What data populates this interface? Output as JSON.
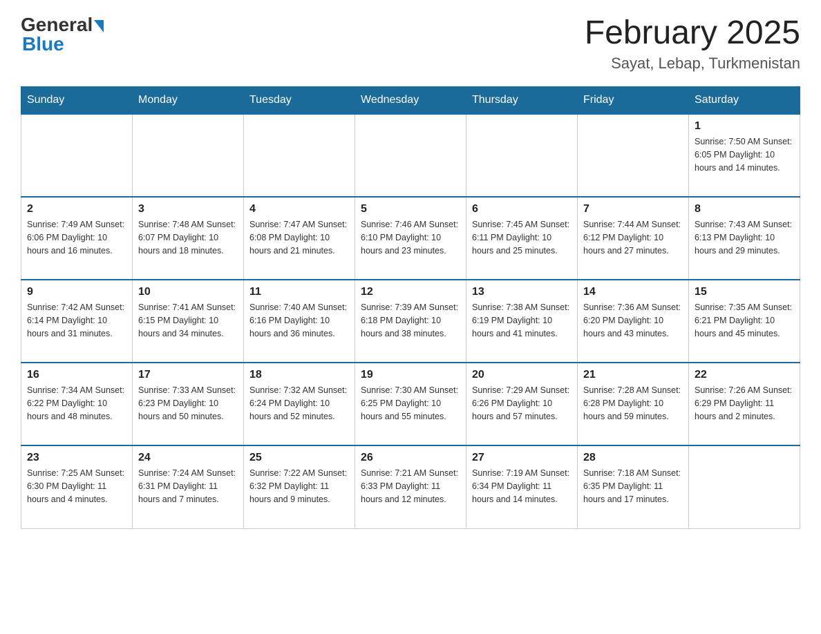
{
  "header": {
    "logo_general": "General",
    "logo_blue": "Blue",
    "month_title": "February 2025",
    "subtitle": "Sayat, Lebap, Turkmenistan"
  },
  "days_of_week": [
    "Sunday",
    "Monday",
    "Tuesday",
    "Wednesday",
    "Thursday",
    "Friday",
    "Saturday"
  ],
  "weeks": [
    [
      {
        "day": "",
        "info": ""
      },
      {
        "day": "",
        "info": ""
      },
      {
        "day": "",
        "info": ""
      },
      {
        "day": "",
        "info": ""
      },
      {
        "day": "",
        "info": ""
      },
      {
        "day": "",
        "info": ""
      },
      {
        "day": "1",
        "info": "Sunrise: 7:50 AM\nSunset: 6:05 PM\nDaylight: 10 hours and 14 minutes."
      }
    ],
    [
      {
        "day": "2",
        "info": "Sunrise: 7:49 AM\nSunset: 6:06 PM\nDaylight: 10 hours and 16 minutes."
      },
      {
        "day": "3",
        "info": "Sunrise: 7:48 AM\nSunset: 6:07 PM\nDaylight: 10 hours and 18 minutes."
      },
      {
        "day": "4",
        "info": "Sunrise: 7:47 AM\nSunset: 6:08 PM\nDaylight: 10 hours and 21 minutes."
      },
      {
        "day": "5",
        "info": "Sunrise: 7:46 AM\nSunset: 6:10 PM\nDaylight: 10 hours and 23 minutes."
      },
      {
        "day": "6",
        "info": "Sunrise: 7:45 AM\nSunset: 6:11 PM\nDaylight: 10 hours and 25 minutes."
      },
      {
        "day": "7",
        "info": "Sunrise: 7:44 AM\nSunset: 6:12 PM\nDaylight: 10 hours and 27 minutes."
      },
      {
        "day": "8",
        "info": "Sunrise: 7:43 AM\nSunset: 6:13 PM\nDaylight: 10 hours and 29 minutes."
      }
    ],
    [
      {
        "day": "9",
        "info": "Sunrise: 7:42 AM\nSunset: 6:14 PM\nDaylight: 10 hours and 31 minutes."
      },
      {
        "day": "10",
        "info": "Sunrise: 7:41 AM\nSunset: 6:15 PM\nDaylight: 10 hours and 34 minutes."
      },
      {
        "day": "11",
        "info": "Sunrise: 7:40 AM\nSunset: 6:16 PM\nDaylight: 10 hours and 36 minutes."
      },
      {
        "day": "12",
        "info": "Sunrise: 7:39 AM\nSunset: 6:18 PM\nDaylight: 10 hours and 38 minutes."
      },
      {
        "day": "13",
        "info": "Sunrise: 7:38 AM\nSunset: 6:19 PM\nDaylight: 10 hours and 41 minutes."
      },
      {
        "day": "14",
        "info": "Sunrise: 7:36 AM\nSunset: 6:20 PM\nDaylight: 10 hours and 43 minutes."
      },
      {
        "day": "15",
        "info": "Sunrise: 7:35 AM\nSunset: 6:21 PM\nDaylight: 10 hours and 45 minutes."
      }
    ],
    [
      {
        "day": "16",
        "info": "Sunrise: 7:34 AM\nSunset: 6:22 PM\nDaylight: 10 hours and 48 minutes."
      },
      {
        "day": "17",
        "info": "Sunrise: 7:33 AM\nSunset: 6:23 PM\nDaylight: 10 hours and 50 minutes."
      },
      {
        "day": "18",
        "info": "Sunrise: 7:32 AM\nSunset: 6:24 PM\nDaylight: 10 hours and 52 minutes."
      },
      {
        "day": "19",
        "info": "Sunrise: 7:30 AM\nSunset: 6:25 PM\nDaylight: 10 hours and 55 minutes."
      },
      {
        "day": "20",
        "info": "Sunrise: 7:29 AM\nSunset: 6:26 PM\nDaylight: 10 hours and 57 minutes."
      },
      {
        "day": "21",
        "info": "Sunrise: 7:28 AM\nSunset: 6:28 PM\nDaylight: 10 hours and 59 minutes."
      },
      {
        "day": "22",
        "info": "Sunrise: 7:26 AM\nSunset: 6:29 PM\nDaylight: 11 hours and 2 minutes."
      }
    ],
    [
      {
        "day": "23",
        "info": "Sunrise: 7:25 AM\nSunset: 6:30 PM\nDaylight: 11 hours and 4 minutes."
      },
      {
        "day": "24",
        "info": "Sunrise: 7:24 AM\nSunset: 6:31 PM\nDaylight: 11 hours and 7 minutes."
      },
      {
        "day": "25",
        "info": "Sunrise: 7:22 AM\nSunset: 6:32 PM\nDaylight: 11 hours and 9 minutes."
      },
      {
        "day": "26",
        "info": "Sunrise: 7:21 AM\nSunset: 6:33 PM\nDaylight: 11 hours and 12 minutes."
      },
      {
        "day": "27",
        "info": "Sunrise: 7:19 AM\nSunset: 6:34 PM\nDaylight: 11 hours and 14 minutes."
      },
      {
        "day": "28",
        "info": "Sunrise: 7:18 AM\nSunset: 6:35 PM\nDaylight: 11 hours and 17 minutes."
      },
      {
        "day": "",
        "info": ""
      }
    ]
  ]
}
